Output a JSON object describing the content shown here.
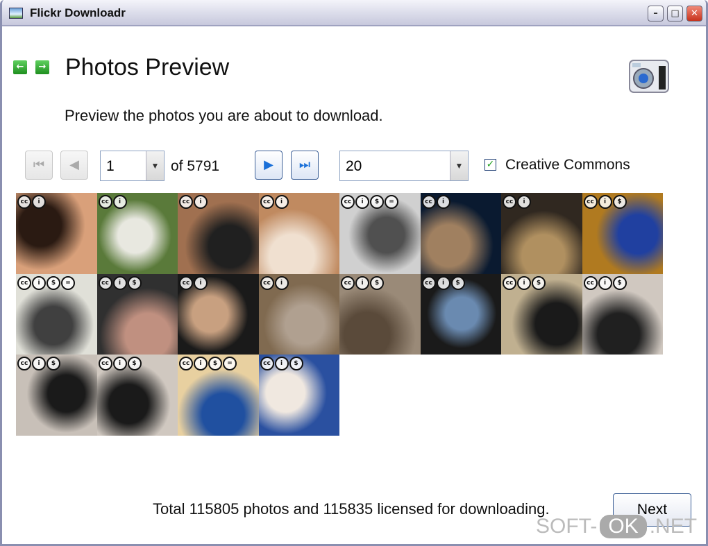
{
  "window": {
    "title": "Flickr Downloadr",
    "controls": [
      "minimize",
      "maximize",
      "close"
    ]
  },
  "header": {
    "title": "Photos Preview",
    "subtitle": "Preview the photos you are about to download.",
    "back_icon": "arrow-left-icon",
    "forward_icon": "arrow-right-icon",
    "logo_icon": "camera-icon"
  },
  "pager": {
    "page": "1",
    "of_label": "of 5791",
    "per_page": "20",
    "creative_commons_label": "Creative Commons",
    "creative_commons_checked": true
  },
  "photos": [
    {
      "licenses": [
        "cc",
        "by"
      ],
      "colors": [
        "#d9a07a",
        "#2a1a12"
      ]
    },
    {
      "licenses": [
        "cc",
        "by"
      ],
      "colors": [
        "#5a7a3a",
        "#e8e8e0"
      ]
    },
    {
      "licenses": [
        "cc",
        "by"
      ],
      "colors": [
        "#a07050",
        "#202020"
      ]
    },
    {
      "licenses": [
        "cc",
        "by"
      ],
      "colors": [
        "#c08a60",
        "#f0e0d0"
      ]
    },
    {
      "licenses": [
        "cc",
        "by",
        "nc",
        "nd"
      ],
      "colors": [
        "#d0d0d0",
        "#505050"
      ]
    },
    {
      "licenses": [
        "cc",
        "by"
      ],
      "colors": [
        "#0a1a30",
        "#a08060"
      ]
    },
    {
      "licenses": [
        "cc",
        "by"
      ],
      "colors": [
        "#302820",
        "#b09060"
      ]
    },
    {
      "licenses": [
        "cc",
        "by",
        "nc"
      ],
      "colors": [
        "#b07a20",
        "#2040a0"
      ]
    },
    {
      "licenses": [
        "cc",
        "by",
        "nc",
        "nd"
      ],
      "colors": [
        "#e0e0d8",
        "#404040"
      ]
    },
    {
      "licenses": [
        "cc",
        "by",
        "nc"
      ],
      "colors": [
        "#303030",
        "#c09080"
      ]
    },
    {
      "licenses": [
        "cc",
        "by"
      ],
      "colors": [
        "#1a1a1a",
        "#c8a080"
      ]
    },
    {
      "licenses": [
        "cc",
        "by"
      ],
      "colors": [
        "#806a50",
        "#b0a090"
      ]
    },
    {
      "licenses": [
        "cc",
        "by",
        "nc"
      ],
      "colors": [
        "#9a8a78",
        "#5a4a3a"
      ]
    },
    {
      "licenses": [
        "cc",
        "by",
        "nc"
      ],
      "colors": [
        "#1a1a1a",
        "#6a8ab0"
      ]
    },
    {
      "licenses": [
        "cc",
        "by",
        "nc"
      ],
      "colors": [
        "#c0b090",
        "#1a1a1a"
      ]
    },
    {
      "licenses": [
        "cc",
        "by",
        "nc"
      ],
      "colors": [
        "#d0c8c0",
        "#202020"
      ]
    },
    {
      "licenses": [
        "cc",
        "by",
        "nc"
      ],
      "colors": [
        "#c8c0b8",
        "#1a1a1a"
      ]
    },
    {
      "licenses": [
        "cc",
        "by",
        "nc"
      ],
      "colors": [
        "#d0c8c0",
        "#1a1a1a"
      ]
    },
    {
      "licenses": [
        "cc",
        "by",
        "nc",
        "nd"
      ],
      "colors": [
        "#e8d0a0",
        "#2050a0"
      ]
    },
    {
      "licenses": [
        "cc",
        "by",
        "nc"
      ],
      "colors": [
        "#2a50a0",
        "#f0e8e0"
      ]
    }
  ],
  "license_glyphs": {
    "cc": "cc",
    "by": "i",
    "nc": "$",
    "nd": "="
  },
  "footer": {
    "summary": "Total 115805 photos and 115835 licensed for downloading.",
    "next_label": "Next"
  },
  "watermark": {
    "left": "SOFT-",
    "mid": "OK",
    "right": ".NET"
  }
}
